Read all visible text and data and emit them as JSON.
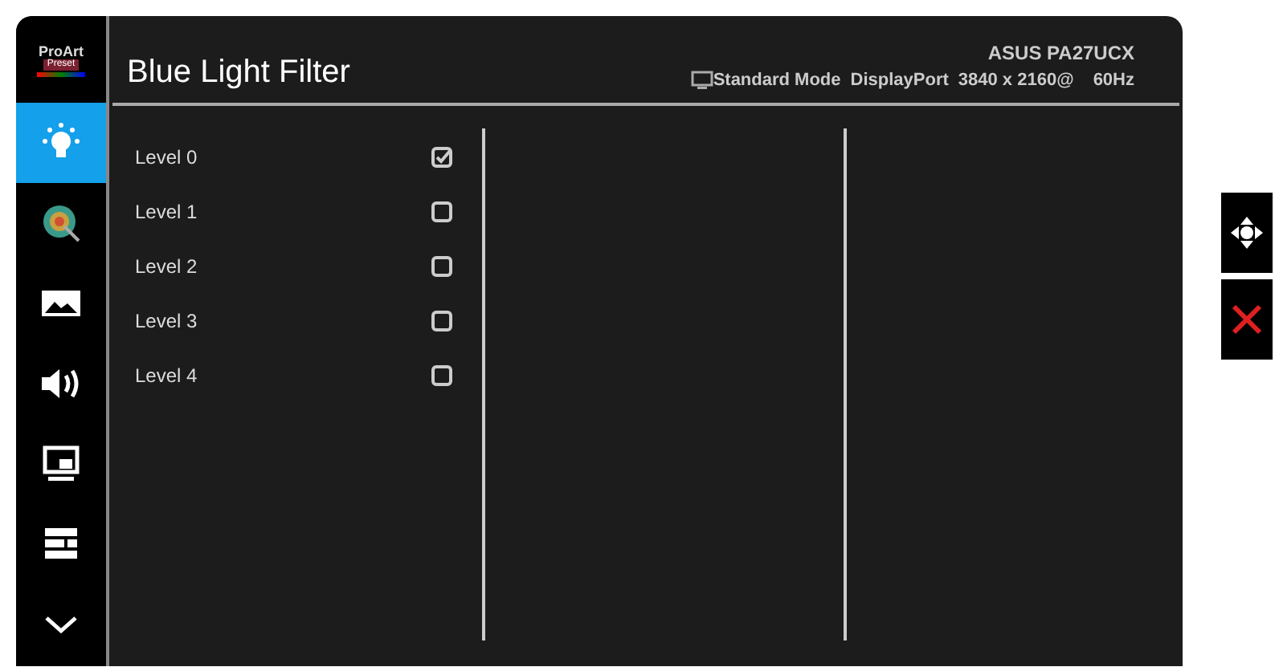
{
  "logo": {
    "line_1": "ProArt",
    "line_2": "Preset"
  },
  "sidebar": {
    "items": [
      {
        "kind": "bulb",
        "selected": true
      },
      {
        "kind": "color",
        "selected": false
      },
      {
        "kind": "image",
        "selected": false
      },
      {
        "kind": "sound",
        "selected": false
      },
      {
        "kind": "pip",
        "selected": false
      },
      {
        "kind": "menu",
        "selected": false
      },
      {
        "kind": "more",
        "selected": false
      }
    ]
  },
  "header": {
    "title": "Blue Light Filter",
    "model": "ASUS PA27UCX",
    "mode": "Standard Mode",
    "input": "DisplayPort",
    "resolution": "3840 x 2160@",
    "refresh": "60Hz"
  },
  "options": [
    {
      "label": "Level 0",
      "checked": true
    },
    {
      "label": "Level 1",
      "checked": false
    },
    {
      "label": "Level 2",
      "checked": false
    },
    {
      "label": "Level 3",
      "checked": false
    },
    {
      "label": "Level 4",
      "checked": false
    }
  ],
  "side_buttons": [
    {
      "kind": "move"
    },
    {
      "kind": "close"
    }
  ]
}
